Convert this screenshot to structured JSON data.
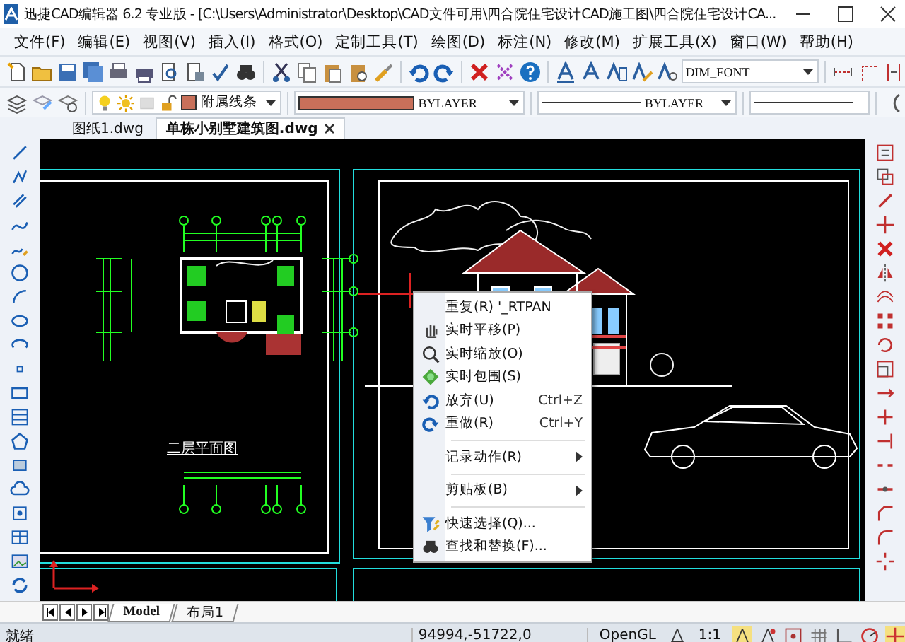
{
  "window": {
    "title": "迅捷CAD编辑器 6.2 专业版  - [C:\\Users\\Administrator\\Desktop\\CAD文件可用\\四合院住宅设计CAD施工图\\四合院住宅设计CA..."
  },
  "menu": [
    "文件(F)",
    "编辑(E)",
    "视图(V)",
    "插入(I)",
    "格式(O)",
    "定制工具(T)",
    "绘图(D)",
    "标注(N)",
    "修改(M)",
    "扩展工具(X)",
    "窗口(W)",
    "帮助(H)"
  ],
  "toolbar": {
    "font_combo": "DIM_FONT",
    "layer_combo": "附属线条",
    "color_combo": "BYLAYER",
    "linetype_combo": "BYLAYER"
  },
  "doc_tabs": [
    {
      "label": "图纸1.dwg",
      "selected": false
    },
    {
      "label": "单栋小别墅建筑图.dwg",
      "selected": true
    }
  ],
  "drawing": {
    "plan_title": "二层平面图"
  },
  "context_menu": [
    {
      "kind": "item",
      "label": "重复(R) '_RTPAN",
      "submenu": false
    },
    {
      "kind": "item",
      "label": "实时平移(P)",
      "submenu": false
    },
    {
      "kind": "item",
      "label": "实时缩放(O)",
      "submenu": false
    },
    {
      "kind": "item",
      "label": "实时包围(S)",
      "submenu": false
    },
    {
      "kind": "item",
      "label": "放弃(U)",
      "shortcut": "Ctrl+Z",
      "submenu": false
    },
    {
      "kind": "item",
      "label": "重做(R)",
      "shortcut": "Ctrl+Y",
      "submenu": false
    },
    {
      "kind": "separator"
    },
    {
      "kind": "item",
      "label": "记录动作(R)",
      "submenu": true
    },
    {
      "kind": "separator"
    },
    {
      "kind": "item",
      "label": "剪贴板(B)",
      "submenu": true
    },
    {
      "kind": "separator"
    },
    {
      "kind": "item",
      "label": "快速选择(Q)...",
      "submenu": false
    },
    {
      "kind": "item",
      "label": "查找和替换(F)...",
      "submenu": false
    }
  ],
  "layout_tabs": [
    {
      "label": "Model",
      "selected": true
    },
    {
      "label": "布局1",
      "selected": false
    }
  ],
  "status_bar": {
    "message": "就绪",
    "coordinates": "94994,-51722,0",
    "renderer": "OpenGL",
    "scale": "1:1"
  }
}
